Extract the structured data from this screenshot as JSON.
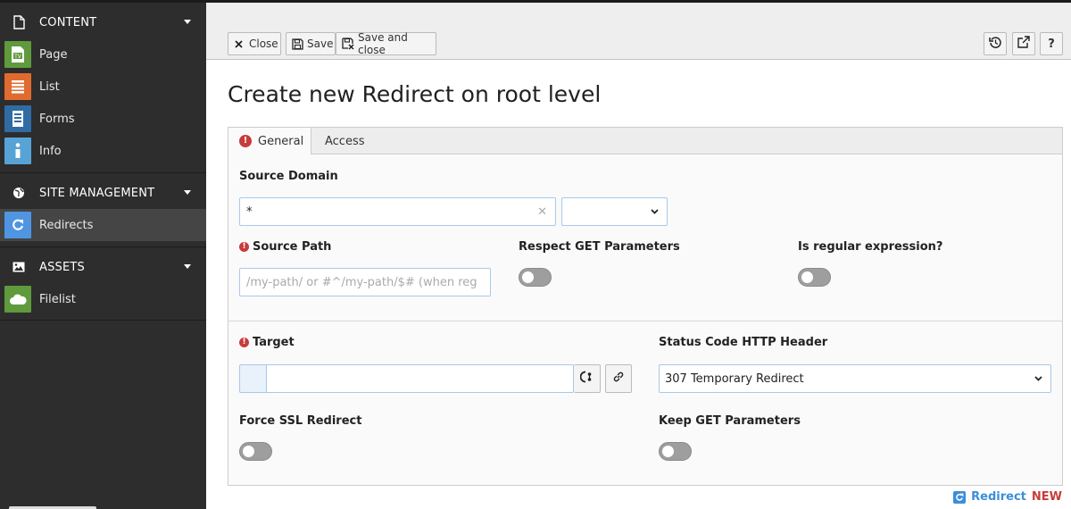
{
  "sidebar": {
    "groups": [
      {
        "label": "CONTENT",
        "icon": "page-icon"
      },
      {
        "label": "SITE MANAGEMENT",
        "icon": "globe-icon"
      },
      {
        "label": "ASSETS",
        "icon": "image-icon"
      }
    ],
    "items": [
      {
        "label": "Page",
        "icon": "page-tv-icon",
        "color": "#5f9a3c"
      },
      {
        "label": "List",
        "icon": "list-icon",
        "color": "#e06b2f"
      },
      {
        "label": "Forms",
        "icon": "forms-icon",
        "color": "#2f6ca4"
      },
      {
        "label": "Info",
        "icon": "info-icon",
        "color": "#58a3d6"
      },
      {
        "label": "Redirects",
        "icon": "redirect-icon",
        "color": "#4f95e1",
        "active": true
      },
      {
        "label": "Filelist",
        "icon": "cloud-icon",
        "color": "#5f9a3c"
      }
    ]
  },
  "toolbar": {
    "close_label": "Close",
    "save_label": "Save",
    "save_close_label": "Save and close",
    "help_label": "?"
  },
  "page": {
    "title": "Create new Redirect on root level"
  },
  "tabs": [
    {
      "label": "General",
      "active": true,
      "has_error": true
    },
    {
      "label": "Access",
      "active": false
    }
  ],
  "form": {
    "source_domain": {
      "label": "Source Domain",
      "value": "*",
      "select_value": ""
    },
    "source_path": {
      "label": "Source Path",
      "placeholder": "/my-path/ or #^/my-path/$# (when reg"
    },
    "respect_get": {
      "label": "Respect GET Parameters",
      "checked": false
    },
    "is_regex": {
      "label": "Is regular expression?",
      "checked": false
    },
    "target": {
      "label": "Target",
      "value": ""
    },
    "status_code": {
      "label": "Status Code HTTP Header",
      "value": "307 Temporary Redirect"
    },
    "force_ssl": {
      "label": "Force SSL Redirect",
      "checked": false
    },
    "keep_get": {
      "label": "Keep GET Parameters",
      "checked": false
    }
  },
  "footer": {
    "module_name": "Redirect",
    "badge": "NEW"
  },
  "colors": {
    "accent": "#3d8eda",
    "error": "#c83c3c",
    "sidebar_bg": "#2d2d2d"
  }
}
